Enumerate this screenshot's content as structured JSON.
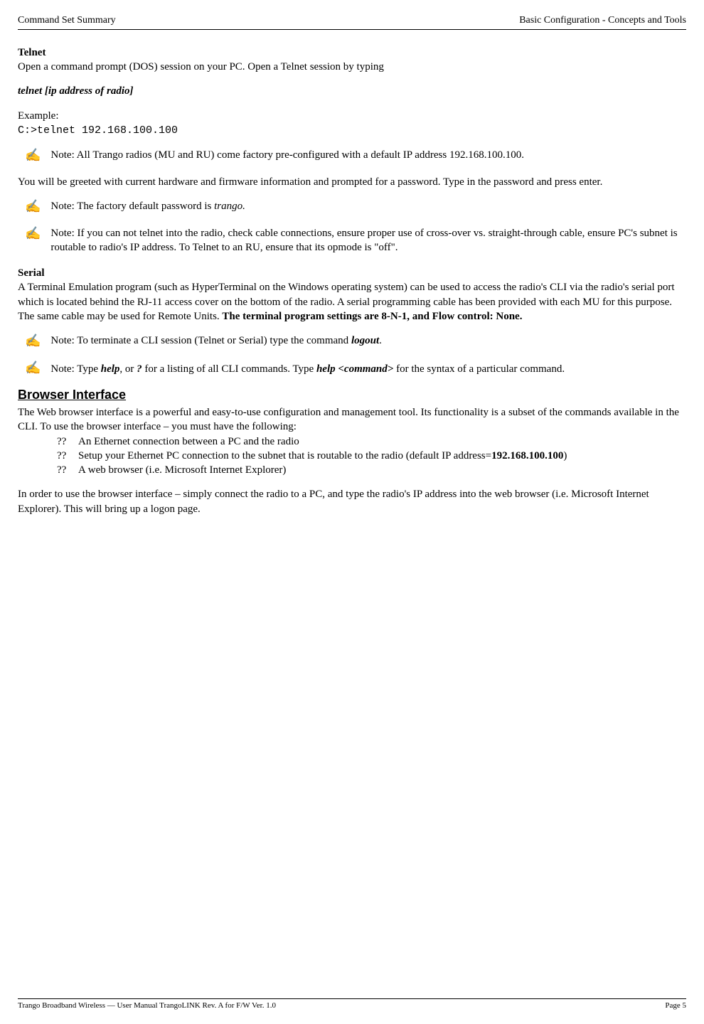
{
  "header": {
    "left": "Command Set Summary",
    "right": "Basic Configuration - Concepts and Tools"
  },
  "telnet": {
    "heading": "Telnet",
    "intro": "Open a command prompt (DOS) session on your PC.  Open a Telnet session by typing",
    "syntax": "telnet [ip address of radio]",
    "example_label": "Example:",
    "example_cmd": "C:>telnet 192.168.100.100",
    "note1": "Note:  All Trango radios (MU and RU) come factory pre-configured with a default IP address 192.168.100.100.",
    "greeting": "You will be greeted with current hardware and firmware information and prompted for a password.  Type in the password and press enter.",
    "note2_pre": "Note: The factory default password is ",
    "note2_em": "trango.",
    "note3": "Note:  If you can not telnet into the radio, check cable connections, ensure proper use of cross-over vs. straight-through cable, ensure PC's subnet is routable to radio's IP address.  To Telnet to an RU, ensure that its opmode is \"off\"."
  },
  "serial": {
    "heading": "Serial",
    "body1": "A Terminal Emulation program (such as HyperTerminal on the Windows operating system) can be used to access the radio's CLI via the radio's serial port which is located behind the RJ-11 access cover on the bottom of the radio.  A serial programming cable has been provided with each MU for this purpose.  The same cable may be used for Remote Units.  ",
    "body1_bold": "The terminal program settings are 8-N-1, and Flow control: None.",
    "note1_pre": "Note:  To terminate a CLI session (Telnet or Serial) type the command ",
    "note1_em": "logout",
    "note1_post": ".",
    "note2_a": "Note:  Type ",
    "note2_help": "help",
    "note2_b": ", or ",
    "note2_q": "?",
    "note2_c": " for a listing of all CLI commands.  Type ",
    "note2_helpcmd": "help <command>",
    "note2_d": " for the syntax of a particular command."
  },
  "browser": {
    "heading": "Browser Interface",
    "intro": "The Web browser interface is a powerful and easy-to-use configuration and management tool.  Its functionality is a subset of the commands available in the CLI.  To use the browser interface – you must have the following:",
    "items": [
      {
        "b": "??",
        "t": "An Ethernet connection between a PC and the radio"
      },
      {
        "b": "??",
        "t1": "Setup your Ethernet PC connection to the subnet that is routable to the radio (default IP address=",
        "bold": "192.168.100.100",
        "t2": ")"
      },
      {
        "b": "??",
        "t": "A web browser (i.e. Microsoft Internet Explorer)"
      }
    ],
    "outro": "In order to use the browser interface – simply connect the radio to a PC, and type the radio's IP address into the web browser (i.e. Microsoft Internet Explorer).  This will bring up a logon page."
  },
  "footer": {
    "left": "Trango Broadband Wireless — User Manual TrangoLINK  Rev. A  for F/W Ver. 1.0",
    "right": "Page 5"
  },
  "pencil": "✍"
}
